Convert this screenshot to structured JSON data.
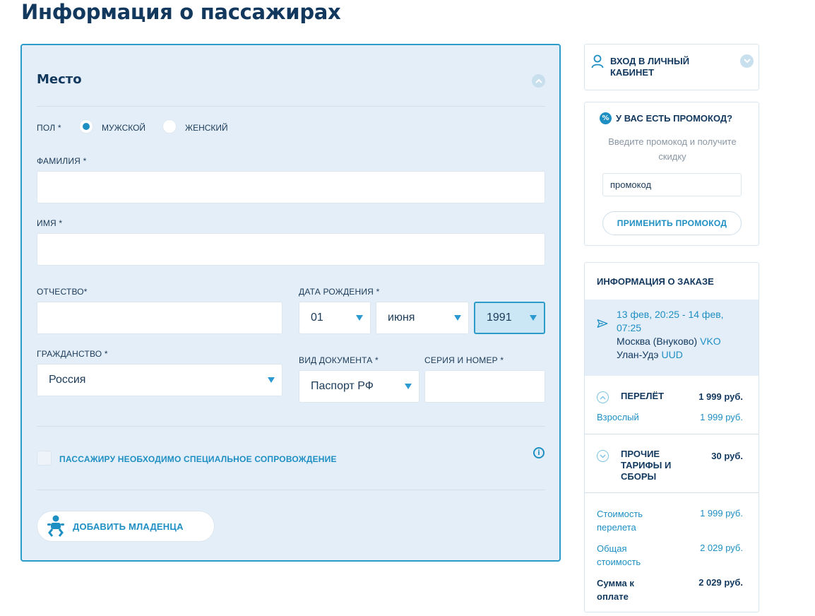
{
  "page": {
    "title": "Информация о пассажирах"
  },
  "passenger": {
    "section_title": "Место",
    "gender": {
      "label": "ПОЛ *",
      "options": [
        "МУЖСКОЙ",
        "ЖЕНСКИЙ"
      ],
      "selected": "МУЖСКОЙ"
    },
    "surname": {
      "label": "ФАМИЛИЯ *",
      "value": ""
    },
    "name": {
      "label": "ИМЯ *",
      "value": ""
    },
    "patronymic": {
      "label": "ОТЧЕСТВО*",
      "value": ""
    },
    "birth_date": {
      "label": "ДАТА РОЖДЕНИЯ *",
      "day": "01",
      "month": "июня",
      "year": "1991"
    },
    "citizenship": {
      "label": "ГРАЖДАНСТВО *",
      "value": "Россия"
    },
    "document_type": {
      "label": "ВИД ДОКУМЕНТА *",
      "value": "Паспорт РФ"
    },
    "document_number": {
      "label": "СЕРИЯ И НОМЕР *",
      "value": ""
    },
    "special_assistance": {
      "label": "ПАССАЖИРУ НЕОБХОДИМО СПЕЦИАЛЬНОЕ СОПРОВОЖДЕНИЕ",
      "checked": false
    },
    "add_infant_label": "ДОБАВИТЬ МЛАДЕНЦА"
  },
  "sidebar": {
    "login": {
      "line1": "ВХОД В ЛИЧНЫЙ",
      "line2": "КАБИНЕТ"
    },
    "promo": {
      "title": "У ВАС ЕСТЬ ПРОМОКОД?",
      "desc_line1": "Введите промокод и получите",
      "desc_line2": "скидку",
      "input_value": "промокод",
      "apply_label": "ПРИМЕНИТЬ ПРОМОКОД"
    },
    "order": {
      "title": "ИНФОРМАЦИЯ О ЗАКАЗЕ",
      "flight": {
        "time_line1": "13 фев, 20:25 - 14 фев,",
        "time_line2": "07:25",
        "from_city": "Москва (Внуково)",
        "from_code": "VKO",
        "to_city": "Улан-Удэ",
        "to_code": "UUD"
      },
      "flight_section": {
        "label": "ПЕРЕЛЁТ",
        "amount": "1 999 руб.",
        "item_label": "Взрослый",
        "item_amount": "1 999 руб."
      },
      "fees_section": {
        "line1": "ПРОЧИЕ",
        "line2": "ТАРИФЫ И",
        "line3": "СБОРЫ",
        "amount": "30 руб."
      },
      "summary": [
        {
          "line1": "Стоимость",
          "line2": "перелета",
          "amount": "1 999 руб."
        },
        {
          "line1": "Общая",
          "line2": "стоимость",
          "amount": "2 029 руб."
        },
        {
          "line1": "Сумма к",
          "line2": "оплате",
          "amount": "2 029 руб."
        }
      ]
    }
  },
  "colors": {
    "accent": "#1e8fc3",
    "card_bg": "#e4eef8",
    "title": "#12385e",
    "border": "#2c9bc8"
  }
}
